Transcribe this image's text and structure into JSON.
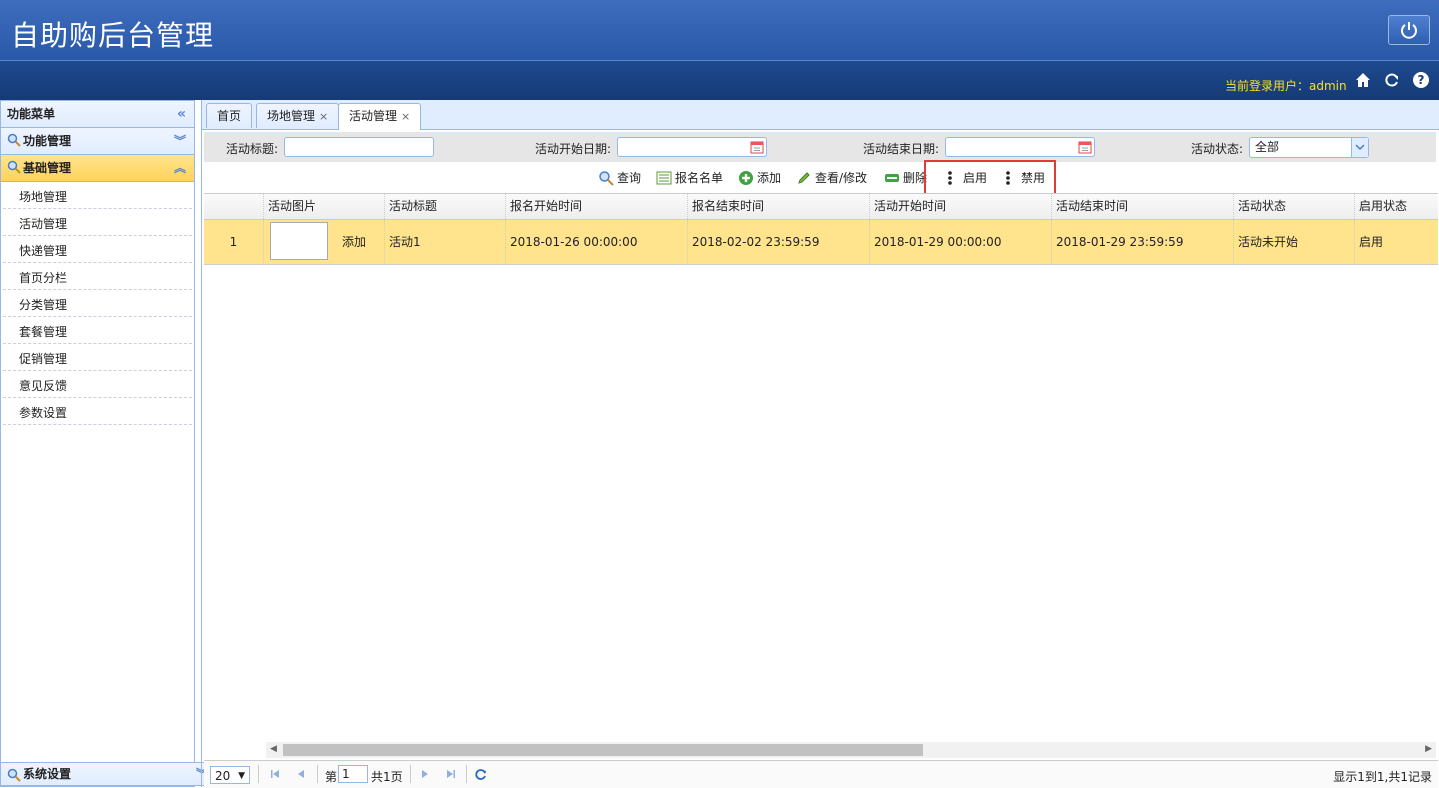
{
  "header": {
    "title": "自助购后台管理",
    "user_label": "当前登录用户：admin"
  },
  "sidebar": {
    "title": "功能菜单",
    "panels": [
      {
        "label": "功能管理"
      },
      {
        "label": "基础管理"
      }
    ],
    "items": [
      "场地管理",
      "活动管理",
      "快递管理",
      "首页分栏",
      "分类管理",
      "套餐管理",
      "促销管理",
      "意见反馈",
      "参数设置"
    ],
    "bottom_panel": "系统设置"
  },
  "tabs": [
    {
      "label": "首页"
    },
    {
      "label": "场地管理",
      "close": "×"
    },
    {
      "label": "活动管理",
      "close": "×"
    }
  ],
  "search": {
    "title_label": "活动标题:",
    "start_label": "活动开始日期:",
    "end_label": "活动结束日期:",
    "status_label": "活动状态:",
    "status_value": "全部"
  },
  "toolbar": {
    "query": "查询",
    "signup_list": "报名名单",
    "add": "添加",
    "view_edit": "查看/修改",
    "delete": "删除",
    "enable": "启用",
    "disable": "禁用"
  },
  "grid": {
    "columns": [
      "活动图片",
      "活动标题",
      "报名开始时间",
      "报名结束时间",
      "活动开始时间",
      "活动结束时间",
      "活动状态",
      "启用状态"
    ],
    "rows": [
      {
        "num": "1",
        "img_link": "添加",
        "title": "活动1",
        "signup_start": "2018-01-26 00:00:00",
        "signup_end": "2018-02-02 23:59:59",
        "act_start": "2018-01-29 00:00:00",
        "act_end": "2018-01-29 23:59:59",
        "status": "活动未开始",
        "enabled": "启用"
      }
    ]
  },
  "pager": {
    "page_size": "20",
    "page_prefix": "第",
    "page_value": "1",
    "page_total": "共1页",
    "summary": "显示1到1,共1记录"
  },
  "colors": {
    "header": "#2a58a8",
    "subbar": "#153a76",
    "accent_border": "#95b8e7",
    "row_highlight": "#ffe48d",
    "user_label": "#f6e21c",
    "annotation": "#e03a3a"
  }
}
